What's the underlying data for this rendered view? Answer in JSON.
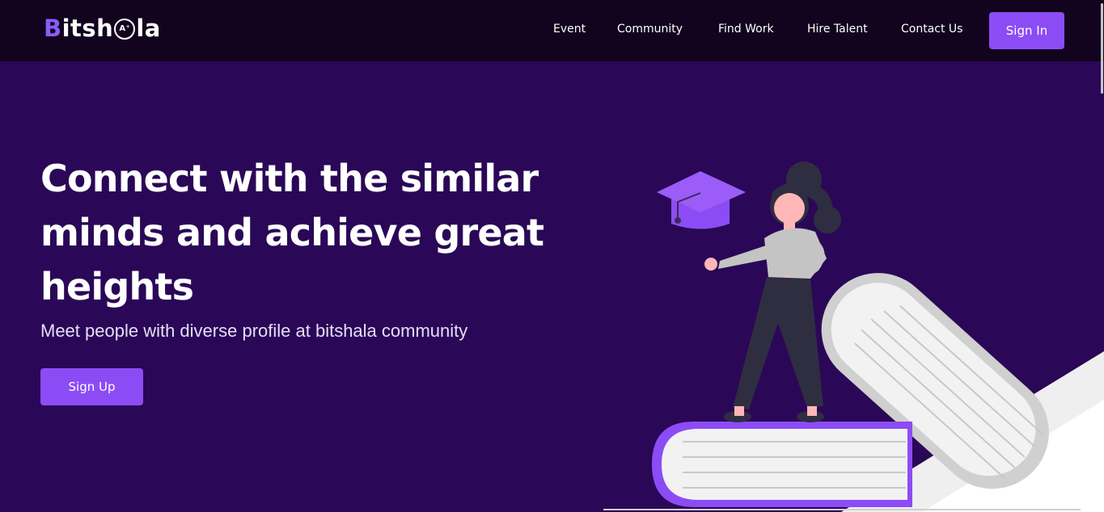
{
  "brand": {
    "logo_pre": "B",
    "logo_mid": "itsh",
    "logo_badge": "A⁺",
    "logo_post": "la"
  },
  "nav": {
    "items": [
      {
        "label": "Event"
      },
      {
        "label": "Community"
      },
      {
        "label": "Find Work"
      },
      {
        "label": "Hire Talent"
      },
      {
        "label": "Contact Us"
      }
    ],
    "signin_label": "Sign In"
  },
  "hero": {
    "title": "Connect with the similar minds and achieve great heights",
    "subtitle": "Meet people with diverse profile at bitshala community",
    "signup_label": "Sign Up"
  },
  "colors": {
    "background": "#2a0757",
    "navbar": "#12031f",
    "accent": "#8c4cf5"
  },
  "illustration": {
    "icon": "student-on-books-illustration"
  }
}
